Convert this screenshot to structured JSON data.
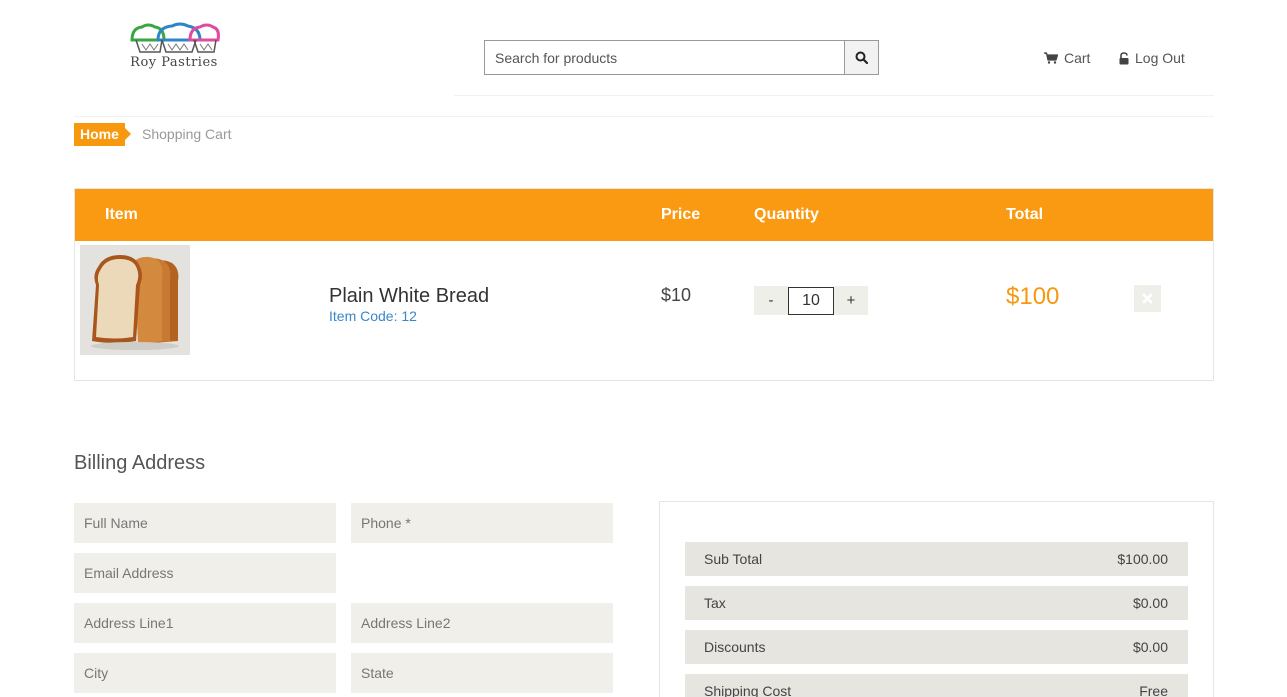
{
  "header": {
    "brand": "Roy Pastries",
    "search_placeholder": "Search for products",
    "cart_label": "Cart",
    "logout_label": "Log Out"
  },
  "breadcrumb": {
    "home": "Home",
    "current": "Shopping Cart"
  },
  "cart": {
    "columns": {
      "item": "Item",
      "price": "Price",
      "quantity": "Quantity",
      "total": "Total"
    },
    "items": [
      {
        "name": "Plain White Bread",
        "code": "Item Code: 12",
        "price": "$10",
        "quantity": "10",
        "total": "$100",
        "decrement": "-",
        "increment": "+"
      }
    ]
  },
  "billing": {
    "title": "Billing Address",
    "fields": {
      "full_name": "Full Name",
      "phone": "Phone *",
      "email": "Email Address",
      "address1": "Address Line1",
      "address2": "Address Line2",
      "city": "City",
      "state": "State"
    }
  },
  "summary": {
    "rows": [
      {
        "label": "Sub Total",
        "value": "$100.00"
      },
      {
        "label": "Tax",
        "value": "$0.00"
      },
      {
        "label": "Discounts",
        "value": "$0.00"
      },
      {
        "label": "Shipping Cost",
        "value": "Free"
      }
    ]
  },
  "colors": {
    "accent": "#f99a12",
    "link": "#3a87c8",
    "field_bg": "#f0efe9"
  }
}
